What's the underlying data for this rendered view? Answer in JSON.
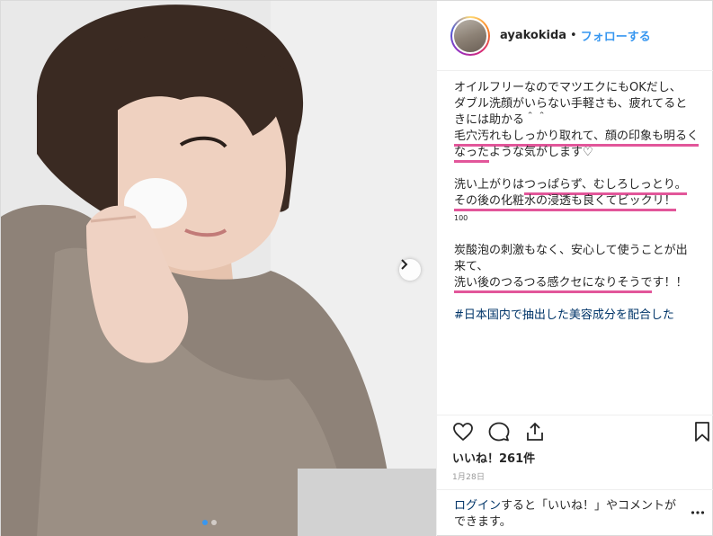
{
  "post": {
    "username": "ayakokida",
    "separator": "•",
    "follow_label": "フォローする"
  },
  "caption": {
    "line1": "オイルフリーなのでマツエクにもOKだし、",
    "line2": "ダブル洗顔がいらない手軽さも、疲れてるときには助かる＾＾",
    "line3_hl": "毛穴汚れもしっかり取れて、顔の印象も明るくなった",
    "line3_rest": "ような気がします♡",
    "line4_pre": "洗い上がりは",
    "line4_hl": "つっぱらず、むしろしっとり。",
    "line5_hl": "その後の化粧水の浸透も良くてビックリ！",
    "line5_small": "100",
    "line6": "炭酸泡の刺激もなく、安心して使うことが出来て、",
    "line7_hl": "洗い後のつるつる感クセになりそうで",
    "line7_rest": "す！！",
    "hashtag": "#日本国内で抽出した美容成分を配合した"
  },
  "stats": {
    "likes": "いいね！261件",
    "date": "1月28日"
  },
  "login_bar": {
    "login_link": "ログイン",
    "rest": "すると「いいね！」やコメントができます。"
  },
  "icons": {
    "like": "heart-icon",
    "comment": "comment-icon",
    "share": "share-icon",
    "save": "bookmark-icon",
    "next": "chevron-right-icon",
    "more": "more-dots-icon"
  },
  "colors": {
    "link_blue": "#3897f0",
    "hashtag_blue": "#003569",
    "highlight_pink": "#e2569a",
    "meta_gray": "#999999"
  }
}
